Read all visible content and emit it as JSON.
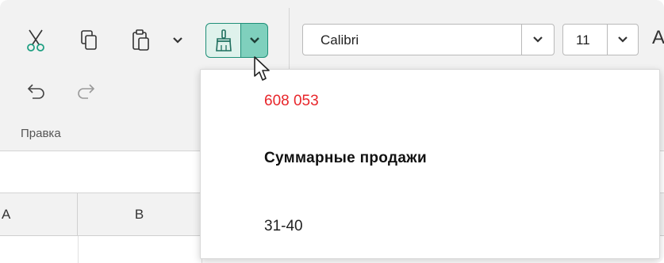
{
  "edit_group": {
    "label": "Правка",
    "cut_icon": "scissors-icon",
    "copy_icon": "copy-icon",
    "paste_icon": "clipboard-icon",
    "undo_icon": "undo-icon",
    "redo_icon": "redo-icon"
  },
  "format_painter": {
    "icon": "paint-brush-icon",
    "dropdown_icon": "chevron-down-icon",
    "accent": "#1f8f78"
  },
  "font": {
    "family_value": "Calibri",
    "size_value": "11",
    "grow_icon": "A"
  },
  "sheet": {
    "columns": [
      "A",
      "B"
    ]
  },
  "format_dropdown": {
    "items": [
      {
        "label": "608 053",
        "color": "#e8262b"
      },
      {
        "label": "Суммарные продажи"
      },
      {
        "label": "31-40"
      }
    ]
  }
}
